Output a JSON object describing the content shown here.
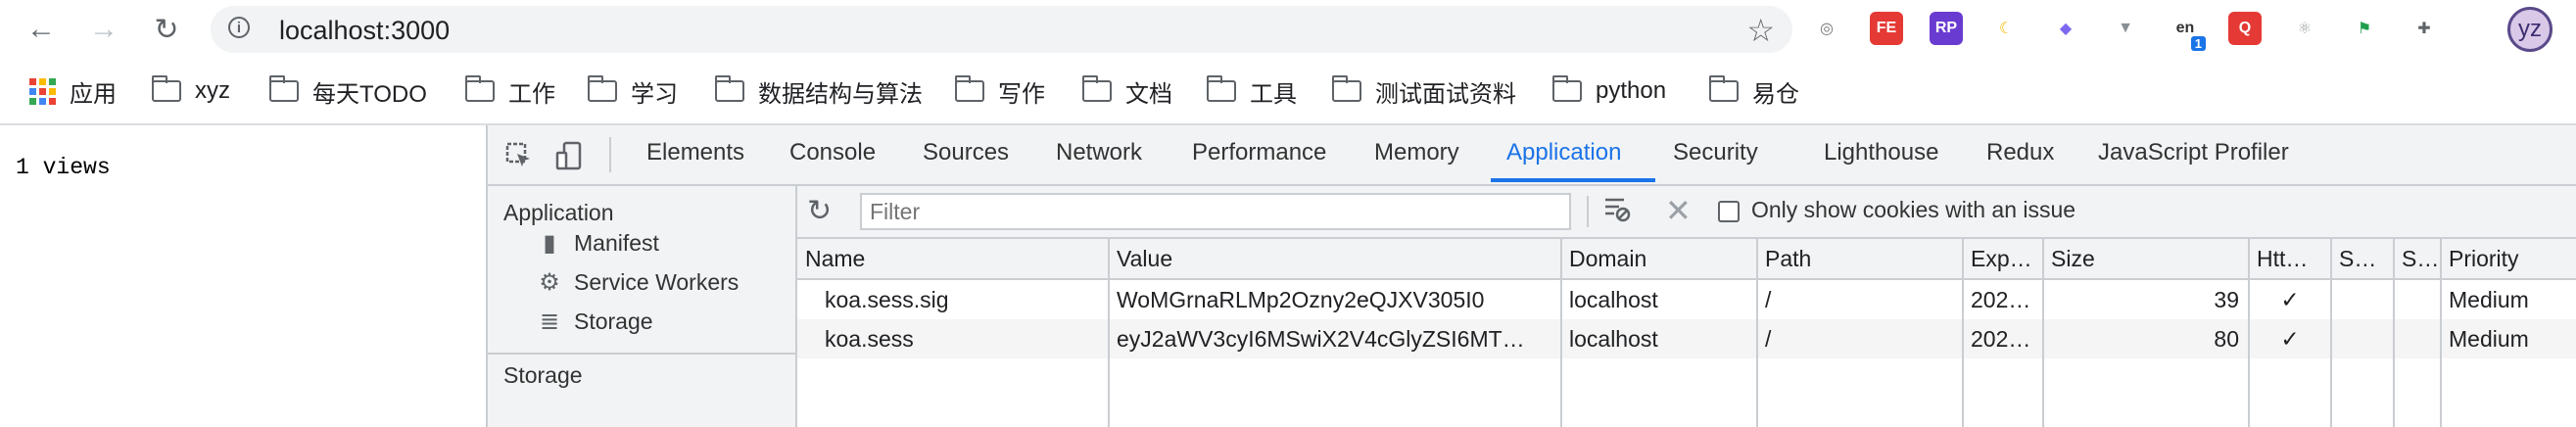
{
  "browser": {
    "url": "localhost:3000",
    "extensions": [
      {
        "name": "dashboard-ext-icon",
        "text": "◎",
        "bg": "#ffffff",
        "fg": "#777777"
      },
      {
        "name": "fe-ext-icon",
        "text": "FE",
        "bg": "#e53935",
        "fg": "#ffffff"
      },
      {
        "name": "rp-ext-icon",
        "text": "RP",
        "bg": "#6a3bd1",
        "fg": "#ffffff"
      },
      {
        "name": "moon-ext-icon",
        "text": "☾",
        "bg": "#ffffff",
        "fg": "#f5b800"
      },
      {
        "name": "fox-ext-icon",
        "text": "◆",
        "bg": "#ffffff",
        "fg": "#7b68ee"
      },
      {
        "name": "vue-ext-icon",
        "text": "▼",
        "bg": "#ffffff",
        "fg": "#8a8f96"
      },
      {
        "name": "translate-ext-icon",
        "text": "en",
        "bg": "#ffffff",
        "fg": "#333333"
      },
      {
        "name": "q-ext-icon",
        "text": "Q",
        "bg": "#e53935",
        "fg": "#ffffff"
      },
      {
        "name": "react-ext-icon",
        "text": "⚛",
        "bg": "#ffffff",
        "fg": "#a0a4a8"
      },
      {
        "name": "flag-ext-icon",
        "text": "⚑",
        "bg": "#ffffff",
        "fg": "#1e9e4a"
      },
      {
        "name": "puzzle-ext-icon",
        "text": "✚",
        "bg": "#ffffff",
        "fg": "#5f6368"
      }
    ],
    "translate_badge": "1",
    "profile_initials": "yz"
  },
  "bookmarks": {
    "apps_label": "应用",
    "folders": [
      "xyz",
      "每天TODO",
      "工作",
      "学习",
      "数据结构与算法",
      "写作",
      "文档",
      "工具",
      "测试面试资料",
      "python",
      "易仓"
    ]
  },
  "page": {
    "text": "1 views"
  },
  "devtools": {
    "tabs": [
      "Elements",
      "Console",
      "Sources",
      "Network",
      "Performance",
      "Memory",
      "Application",
      "Security",
      "Lighthouse",
      "Redux",
      "JavaScript Profiler"
    ],
    "active_tab": "Application",
    "sidebar": {
      "heading": "Application",
      "items": [
        "Manifest",
        "Service Workers",
        "Storage"
      ],
      "section2": "Storage"
    },
    "filter_placeholder": "Filter",
    "issue_label": "Only show cookies with an issue",
    "columns": [
      "Name",
      "Value",
      "Domain",
      "Path",
      "Exp…",
      "Size",
      "Htt…",
      "S…",
      "S…",
      "Priority"
    ],
    "rows": [
      {
        "name": "koa.sess.sig",
        "value": "WoMGrnaRLMp2Ozny2eQJXV305I0",
        "domain": "localhost",
        "path": "/",
        "expires": "202…",
        "size": "39",
        "httponly": "✓",
        "secure": "",
        "samesite": "",
        "priority": "Medium"
      },
      {
        "name": "koa.sess",
        "value": "eyJ2aWV3cyI6MSwiX2V4cGlyZSI6MT…",
        "domain": "localhost",
        "path": "/",
        "expires": "202…",
        "size": "80",
        "httponly": "✓",
        "secure": "",
        "samesite": "",
        "priority": "Medium"
      }
    ]
  }
}
